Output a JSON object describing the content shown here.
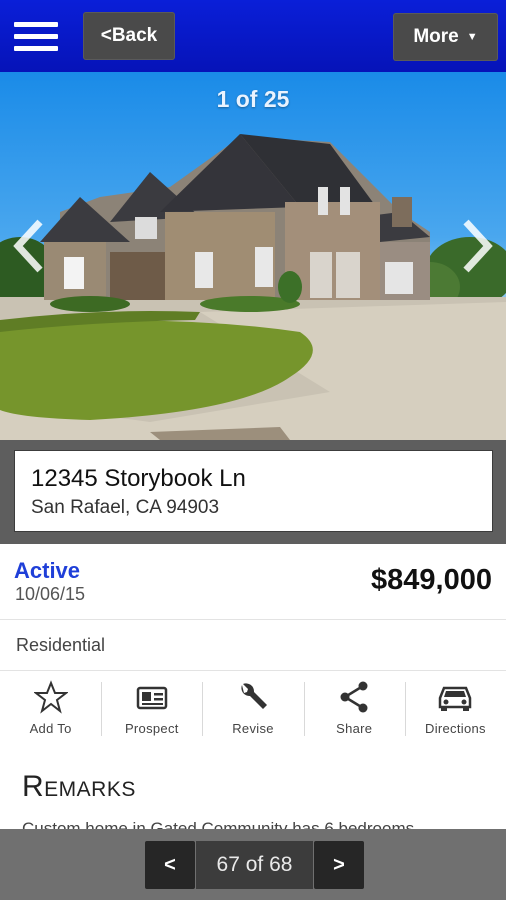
{
  "header": {
    "back_label": "<Back",
    "more_label": "More",
    "more_caret": "▼"
  },
  "photo": {
    "counter": "1 of 25"
  },
  "listing": {
    "street": "12345 Storybook Ln",
    "city_line": "San Rafael, CA 94903",
    "status": "Active",
    "date": "10/06/15",
    "price": "$849,000",
    "type": "Residential"
  },
  "actions": [
    {
      "label": "Add To",
      "icon": "star-icon"
    },
    {
      "label": "Prospect",
      "icon": "id-card-icon"
    },
    {
      "label": "Revise",
      "icon": "wrench-icon"
    },
    {
      "label": "Share",
      "icon": "share-icon"
    },
    {
      "label": "Directions",
      "icon": "car-icon"
    }
  ],
  "remarks": {
    "title": "Remarks",
    "text": "Custom home in Gated Community has 6 bedrooms"
  },
  "pager": {
    "prev": "<",
    "next": ">",
    "label": "67 of 68"
  },
  "colors": {
    "header_blue": "#0a1fd8",
    "status_blue": "#1f3fd8"
  }
}
